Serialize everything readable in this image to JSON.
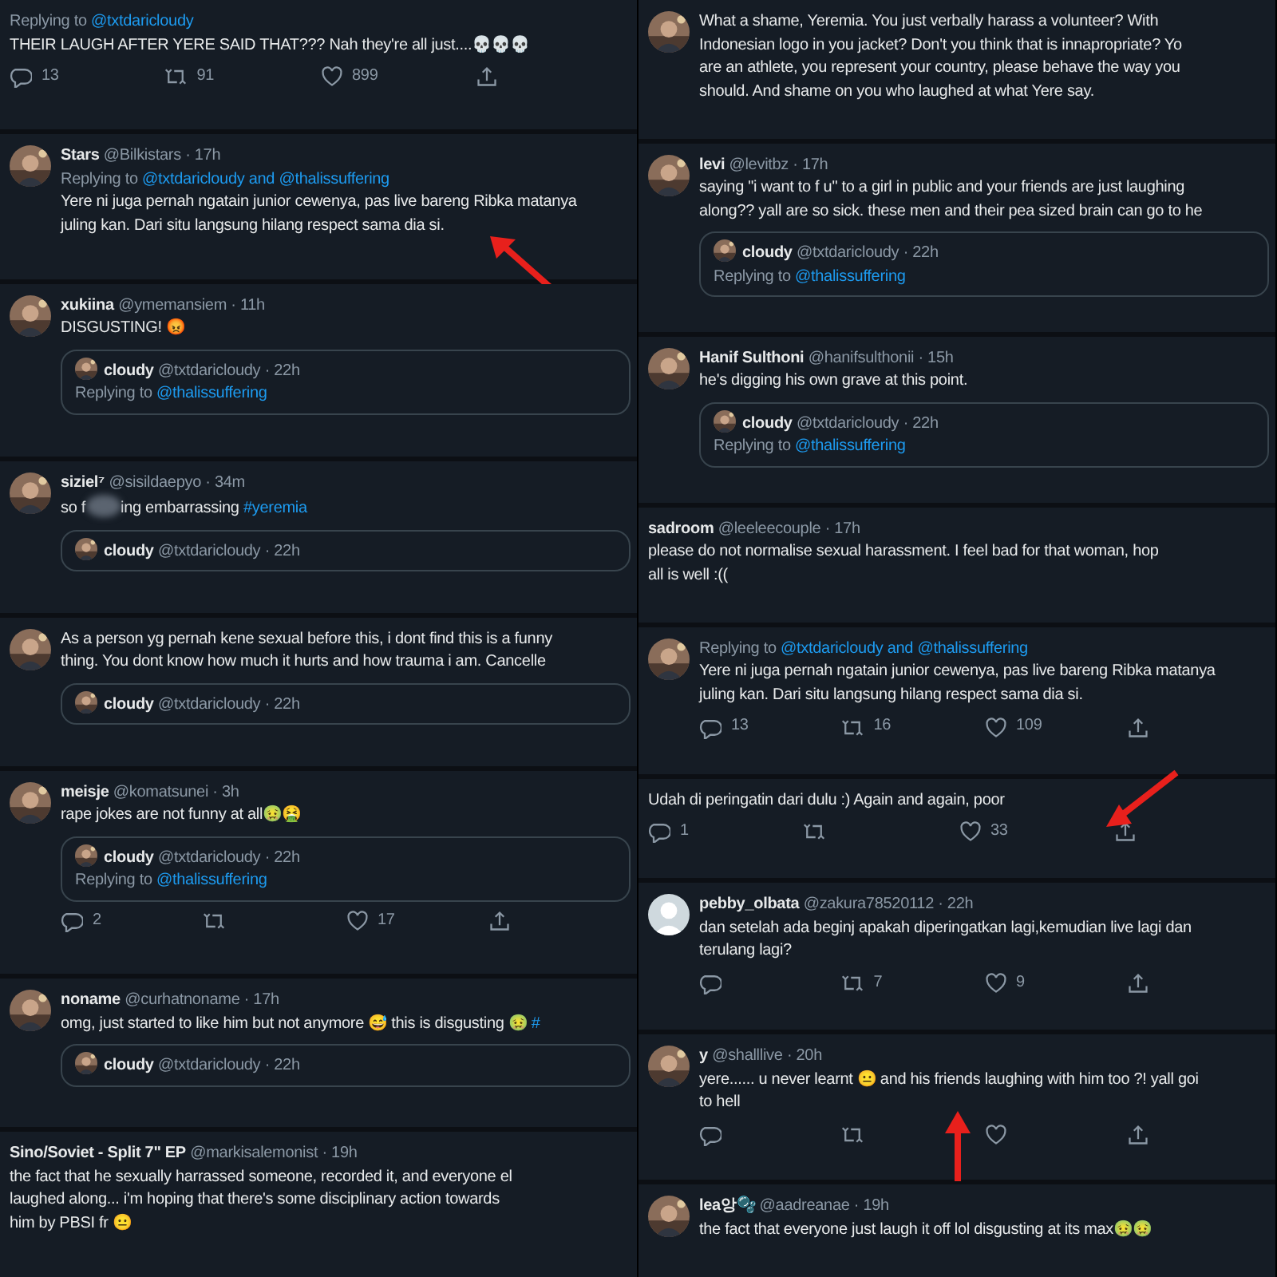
{
  "columns": [
    {
      "tweets": [
        {
          "replying": {
            "prefix": "Replying to ",
            "to": "@txtdaricloudy"
          },
          "lines": [
            "THEIR LAUGH AFTER YERE SAID THAT??? Nah they're all just....💀💀💀"
          ],
          "actions": {
            "reply": "13",
            "retweet": "91",
            "like": "899"
          }
        },
        {
          "avatar": {
            "kind": "picture"
          },
          "name": "Stars",
          "handle": "@Bilkistars",
          "time": "· 17h",
          "replying": {
            "prefix": "Replying to ",
            "to": "@txtdaricloudy and @thalissuffering"
          },
          "lines": [
            "Yere ni juga pernah ngatain junior cewenya, pas live bareng Ribka matanya",
            "juling kan. Dari situ langsung hilang respect sama dia si."
          ],
          "arrow": {
            "kind": "up-left"
          }
        },
        {
          "avatar": {
            "kind": "picture"
          },
          "name": "xukiina",
          "handle": "@ymemansiem",
          "time": "· 11h",
          "lines": [
            "DISGUSTING! 😡"
          ],
          "quote": {
            "name": "cloudy",
            "handle": "@txtdaricloudy",
            "time": "· 22h",
            "replying": {
              "prefix": "Replying to ",
              "to": "@thalissuffering"
            }
          }
        },
        {
          "avatar": {
            "kind": "picture"
          },
          "name": "siziel⁷",
          "handle": "@sisildaepyo",
          "time": "· 34m",
          "lines": [
            {
              "segments": [
                {
                  "kind": "text",
                  "text": "so f"
                },
                {
                  "kind": "blur"
                },
                {
                  "kind": "text",
                  "text": "ing embarrassing "
                },
                {
                  "kind": "hashtag",
                  "text": "#yeremia"
                }
              ]
            }
          ],
          "quote": {
            "name": "cloudy",
            "handle": "@txtdaricloudy",
            "time": "· 22h"
          }
        },
        {
          "avatar": {
            "kind": "picture"
          },
          "lines": [
            "As a person yg pernah kene sexual before this, i dont find this is a funny",
            "thing. You dont know how much it hurts and how trauma i am. Cancelle"
          ],
          "quote": {
            "name": "cloudy",
            "handle": "@txtdaricloudy",
            "time": "· 22h"
          }
        },
        {
          "avatar": {
            "kind": "picture"
          },
          "name": "meisje",
          "handle": "@komatsunei",
          "time": "· 3h",
          "lines": [
            "rape jokes are not funny at all🤢🤮"
          ],
          "quote": {
            "name": "cloudy",
            "handle": "@txtdaricloudy",
            "time": "· 22h",
            "replying": {
              "prefix": "Replying to ",
              "to": "@thalissuffering"
            }
          },
          "actions": {
            "reply": "2",
            "like": "17"
          }
        },
        {
          "avatar": {
            "kind": "picture"
          },
          "name": "noname",
          "handle": "@curhatnoname",
          "time": "· 17h",
          "lines": [
            {
              "segments": [
                {
                  "kind": "text",
                  "text": "omg, just started to like him but not anymore 😅 this is disgusting 🤢 "
                },
                {
                  "kind": "hashtag",
                  "text": "#"
                }
              ]
            }
          ],
          "quote": {
            "name": "cloudy",
            "handle": "@txtdaricloudy",
            "time": "· 22h"
          }
        },
        {
          "name": "Sino/Soviet - Split 7\" EP",
          "handle": "@markisalemonist",
          "time": "· 19h",
          "lines": [
            "the fact that he sexually harrassed someone, recorded it, and everyone el",
            "laughed along... i'm hoping that there's some disciplinary action towards",
            "him by PBSI fr 😐"
          ]
        }
      ]
    },
    {
      "tweets": [
        {
          "avatar": {
            "kind": "picture"
          },
          "lines": [
            "What a shame, Yeremia. You just verbally harass a volunteer? With",
            "Indonesian logo in you jacket? Don't you think that is innapropriate? Yo",
            "are an athlete, you represent your country, please behave the way you",
            "should. And shame on you who laughed at what Yere say."
          ]
        },
        {
          "avatar": {
            "kind": "picture"
          },
          "name": "levi",
          "handle": "@levitbz",
          "time": "· 17h",
          "lines": [
            "saying \"i want to f u\" to a girl in public and your friends are just laughing",
            "along?? yall are so sick. these men and their pea sized brain can go to he"
          ],
          "quote": {
            "name": "cloudy",
            "handle": "@txtdaricloudy",
            "time": "· 22h",
            "replying": {
              "prefix": "Replying to ",
              "to": "@thalissuffering"
            }
          }
        },
        {
          "avatar": {
            "kind": "picture"
          },
          "name": "Hanif Sulthoni",
          "handle": "@hanifsulthonii",
          "time": "· 15h",
          "lines": [
            "he's digging his own grave at this point."
          ],
          "quote": {
            "name": "cloudy",
            "handle": "@txtdaricloudy",
            "time": "· 22h",
            "replying": {
              "prefix": "Replying to ",
              "to": "@thalissuffering"
            }
          }
        },
        {
          "name": "sadroom",
          "handle": "@leeleecouple",
          "time": "· 17h",
          "lines": [
            "please do not normalise sexual harassment. I feel bad for that woman, hop",
            "all is well :(("
          ]
        },
        {
          "avatar": {
            "kind": "picture"
          },
          "replying": {
            "prefix": "Replying to ",
            "to": "@txtdaricloudy and @thalissuffering"
          },
          "lines": [
            "Yere ni juga pernah ngatain junior cewenya, pas live bareng Ribka matanya",
            "juling kan. Dari situ langsung hilang respect sama dia si."
          ],
          "actions": {
            "reply": "13",
            "retweet": "16",
            "like": "109"
          }
        },
        {
          "lines": [
            "Udah di peringatin dari dulu :) Again and again, poor"
          ],
          "actions": {
            "reply": "1",
            "like": "33"
          },
          "arrow": {
            "kind": "down-left"
          }
        },
        {
          "avatar": {
            "kind": "default"
          },
          "name": "pebby_olbata",
          "handle": "@zakura78520112",
          "time": "· 22h",
          "lines": [
            "dan setelah ada beginj apakah diperingatkan lagi,kemudian live lagi dan",
            "terulang lagi?"
          ],
          "actions": {
            "retweet": "7",
            "like": "9"
          }
        },
        {
          "avatar": {
            "kind": "picture"
          },
          "name": "y",
          "handle": "@shalllive",
          "time": "· 20h",
          "lines": [
            "yere...... u never learnt 😐 and his friends laughing with him too ?! yall goi",
            "to hell"
          ],
          "actions": {
            "shown": true
          },
          "arrow": {
            "kind": "up"
          }
        },
        {
          "avatar": {
            "kind": "picture"
          },
          "name": "lea앙🫧",
          "handle": "@aadreanae",
          "time": "· 19h",
          "lines": [
            "the fact that everyone just laugh it off lol disgusting at its max🤢🤢"
          ]
        }
      ]
    }
  ]
}
